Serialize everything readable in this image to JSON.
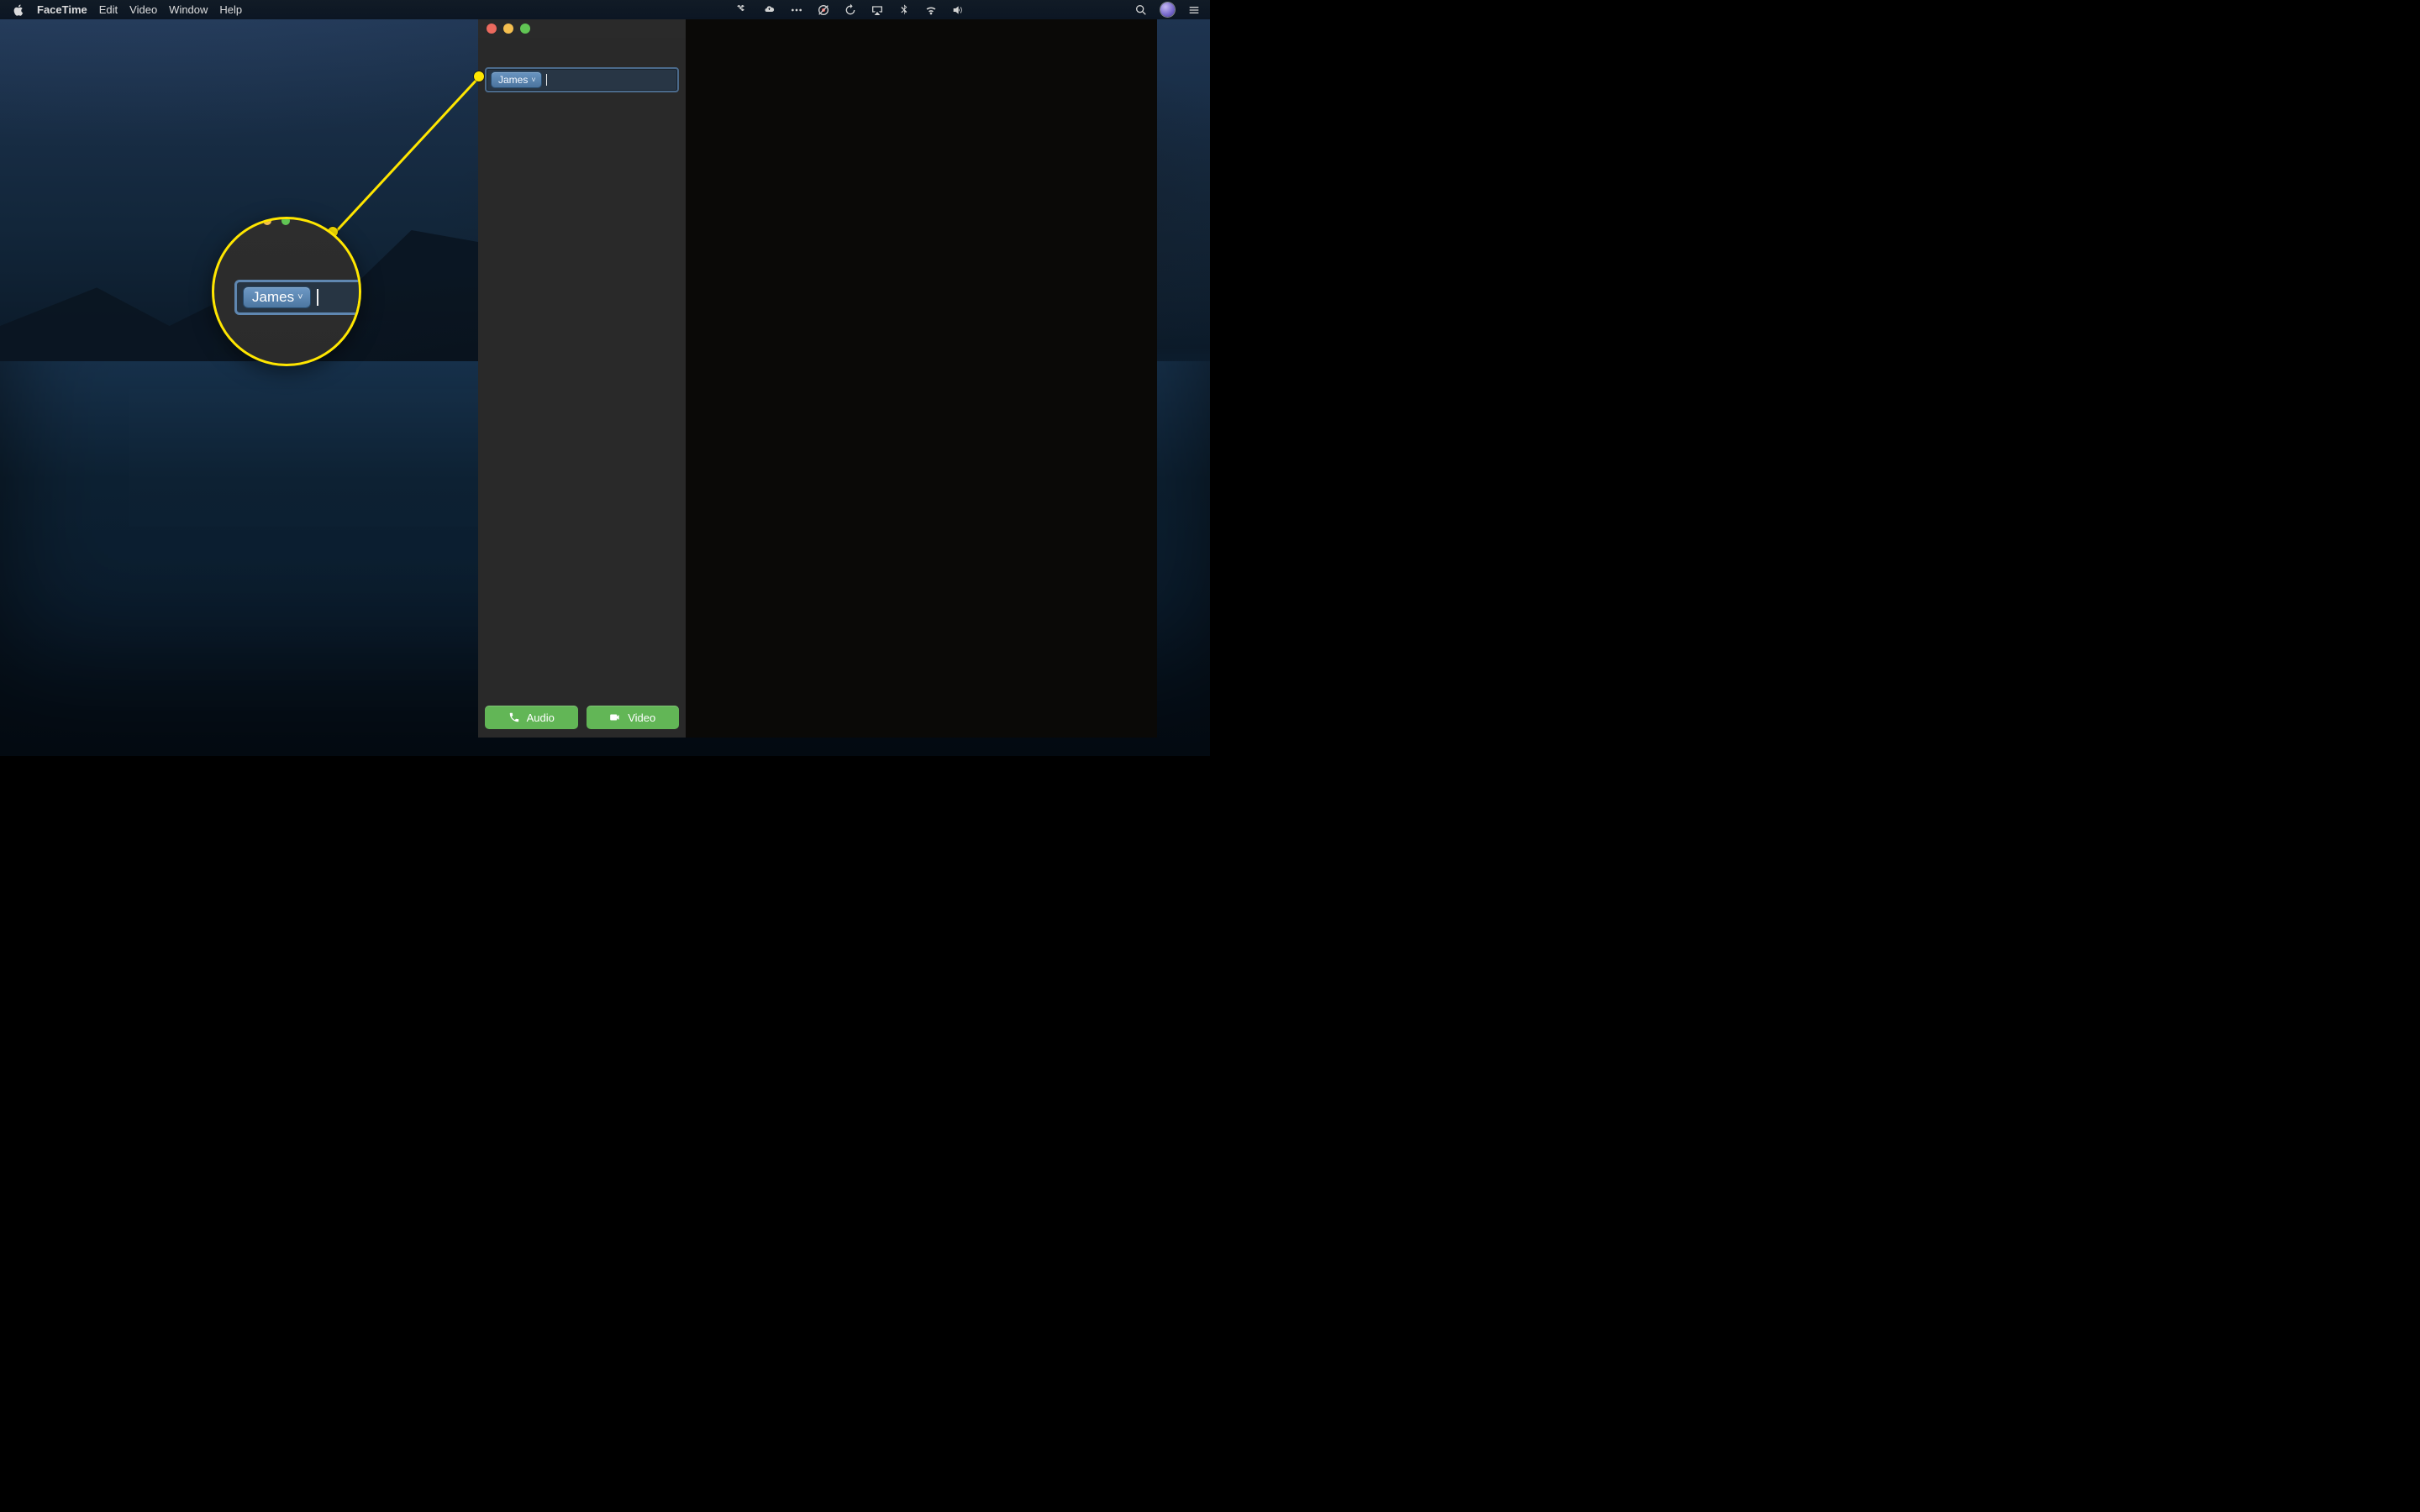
{
  "menubar": {
    "apple_menu": "",
    "items": [
      "FaceTime",
      "Edit",
      "Video",
      "Window",
      "Help"
    ],
    "status_icons": [
      "dropbox-icon",
      "cloud-upload-icon",
      "more-menu-icon",
      "screen-record-off-icon",
      "time-machine-icon",
      "airplay-icon",
      "bluetooth-icon",
      "wifi-icon",
      "volume-icon"
    ],
    "search_icon": "spotlight-search-icon",
    "control_icon": "siri-icon",
    "list_icon": "notification-center-icon"
  },
  "facetime": {
    "to_field": {
      "contact_name": "James",
      "contact_dropdown_glyph": "˅"
    },
    "buttons": {
      "audio": "Audio",
      "video": "Video"
    }
  },
  "callout": {
    "contact_name": "James",
    "contact_dropdown_glyph": "˅"
  }
}
